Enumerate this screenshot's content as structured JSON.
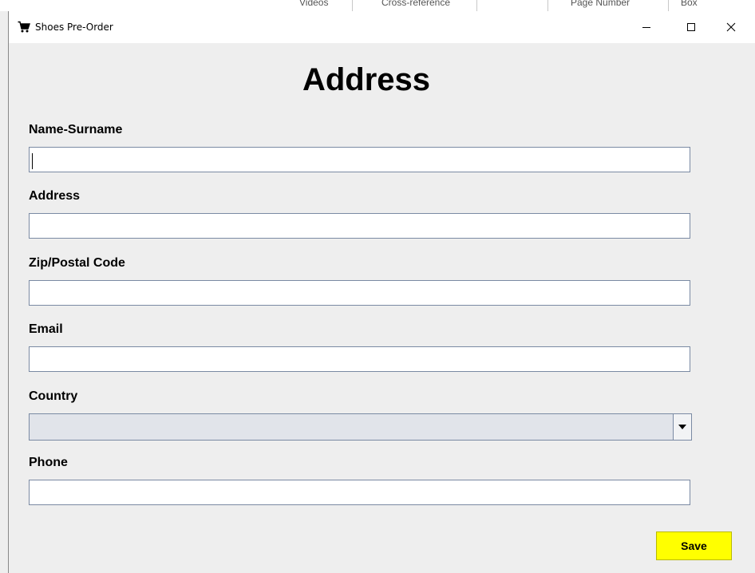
{
  "background_app": {
    "fragments": [
      "Videos",
      "Cross-reference",
      "Page Number",
      "Box"
    ]
  },
  "window": {
    "title": "Shoes Pre-Order",
    "icon": "cart-icon",
    "controls": {
      "minimize": "minimize-icon",
      "maximize": "maximize-icon",
      "close": "close-icon"
    }
  },
  "form": {
    "heading": "Address",
    "fields": {
      "name": {
        "label": "Name-Surname",
        "value": ""
      },
      "address": {
        "label": "Address",
        "value": ""
      },
      "zip": {
        "label": "Zip/Postal Code",
        "value": ""
      },
      "email": {
        "label": "Email",
        "value": ""
      },
      "country": {
        "label": "Country",
        "value": ""
      },
      "phone": {
        "label": "Phone",
        "value": ""
      }
    },
    "save_label": "Save"
  },
  "colors": {
    "save_button": "#ffff00",
    "window_background": "#eeeeee",
    "input_border": "#7a8aa3"
  }
}
